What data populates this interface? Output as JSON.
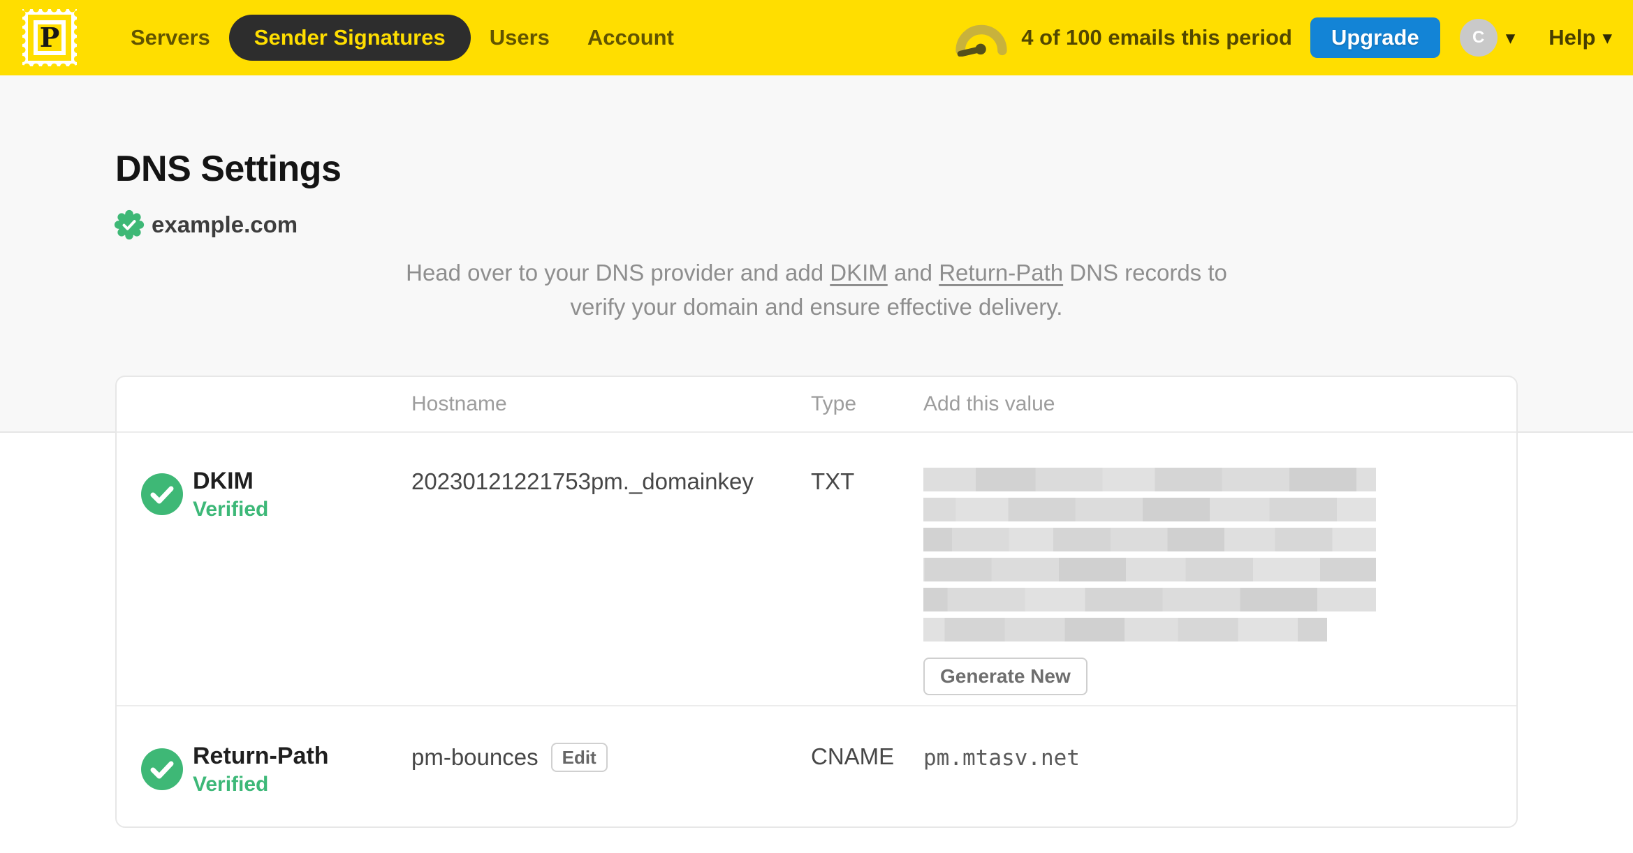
{
  "colors": {
    "brand_yellow": "#FFDE00",
    "nav_pill_dark": "#2d2d2d",
    "upgrade_blue": "#1384D6",
    "verified_green": "#3EB876",
    "page_bg": "#f8f8f8"
  },
  "nav": {
    "brand_letter": "P",
    "items": [
      {
        "label": "Servers",
        "active": false
      },
      {
        "label": "Sender Signatures",
        "active": true
      },
      {
        "label": "Users",
        "active": false
      },
      {
        "label": "Account",
        "active": false
      }
    ],
    "usage_text": "4 of 100 emails this period",
    "upgrade_label": "Upgrade",
    "avatar_initial": "C",
    "help_label": "Help"
  },
  "page": {
    "title": "DNS Settings",
    "domain": "example.com",
    "intro": {
      "line1_prefix": "Head over to your DNS provider and add ",
      "link_dkim": "DKIM",
      "line1_mid": " and ",
      "link_return_path": "Return-Path",
      "line1_suffix": " DNS records to",
      "line2": "verify your domain and ensure effective delivery."
    }
  },
  "table": {
    "headers": {
      "hostname": "Hostname",
      "type": "Type",
      "value": "Add this value"
    },
    "rows": [
      {
        "name": "DKIM",
        "status": "Verified",
        "hostname": "20230121221753pm._domainkey",
        "type": "TXT",
        "value_redacted": true,
        "redacted_lines": 6,
        "action_label": "Generate New"
      },
      {
        "name": "Return-Path",
        "status": "Verified",
        "hostname": "pm-bounces",
        "hostname_action_label": "Edit",
        "type": "CNAME",
        "value": "pm.mtasv.net"
      }
    ]
  }
}
